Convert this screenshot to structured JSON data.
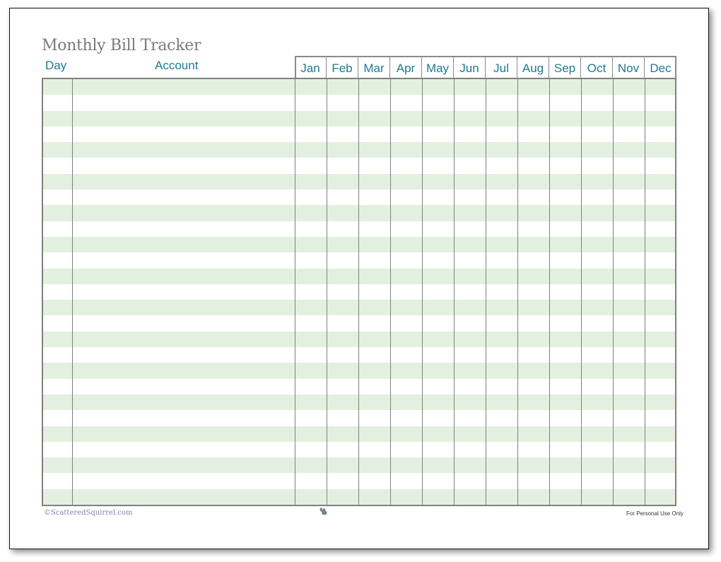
{
  "title": "Monthly Bill Tracker",
  "headers": {
    "day": "Day",
    "account": "Account",
    "months": [
      "Jan",
      "Feb",
      "Mar",
      "Apr",
      "May",
      "Jun",
      "Jul",
      "Aug",
      "Sep",
      "Oct",
      "Nov",
      "Dec"
    ]
  },
  "rows": 27,
  "colors": {
    "accent": "#1d7a93",
    "stripe": "#e3f0df",
    "border": "#7f7f7f",
    "title": "#7a7a7a"
  },
  "footer": {
    "copyright": "©ScatteredSquirrel.com",
    "logo_icon": "squirrel-icon",
    "note": "For Personal Use Only"
  }
}
